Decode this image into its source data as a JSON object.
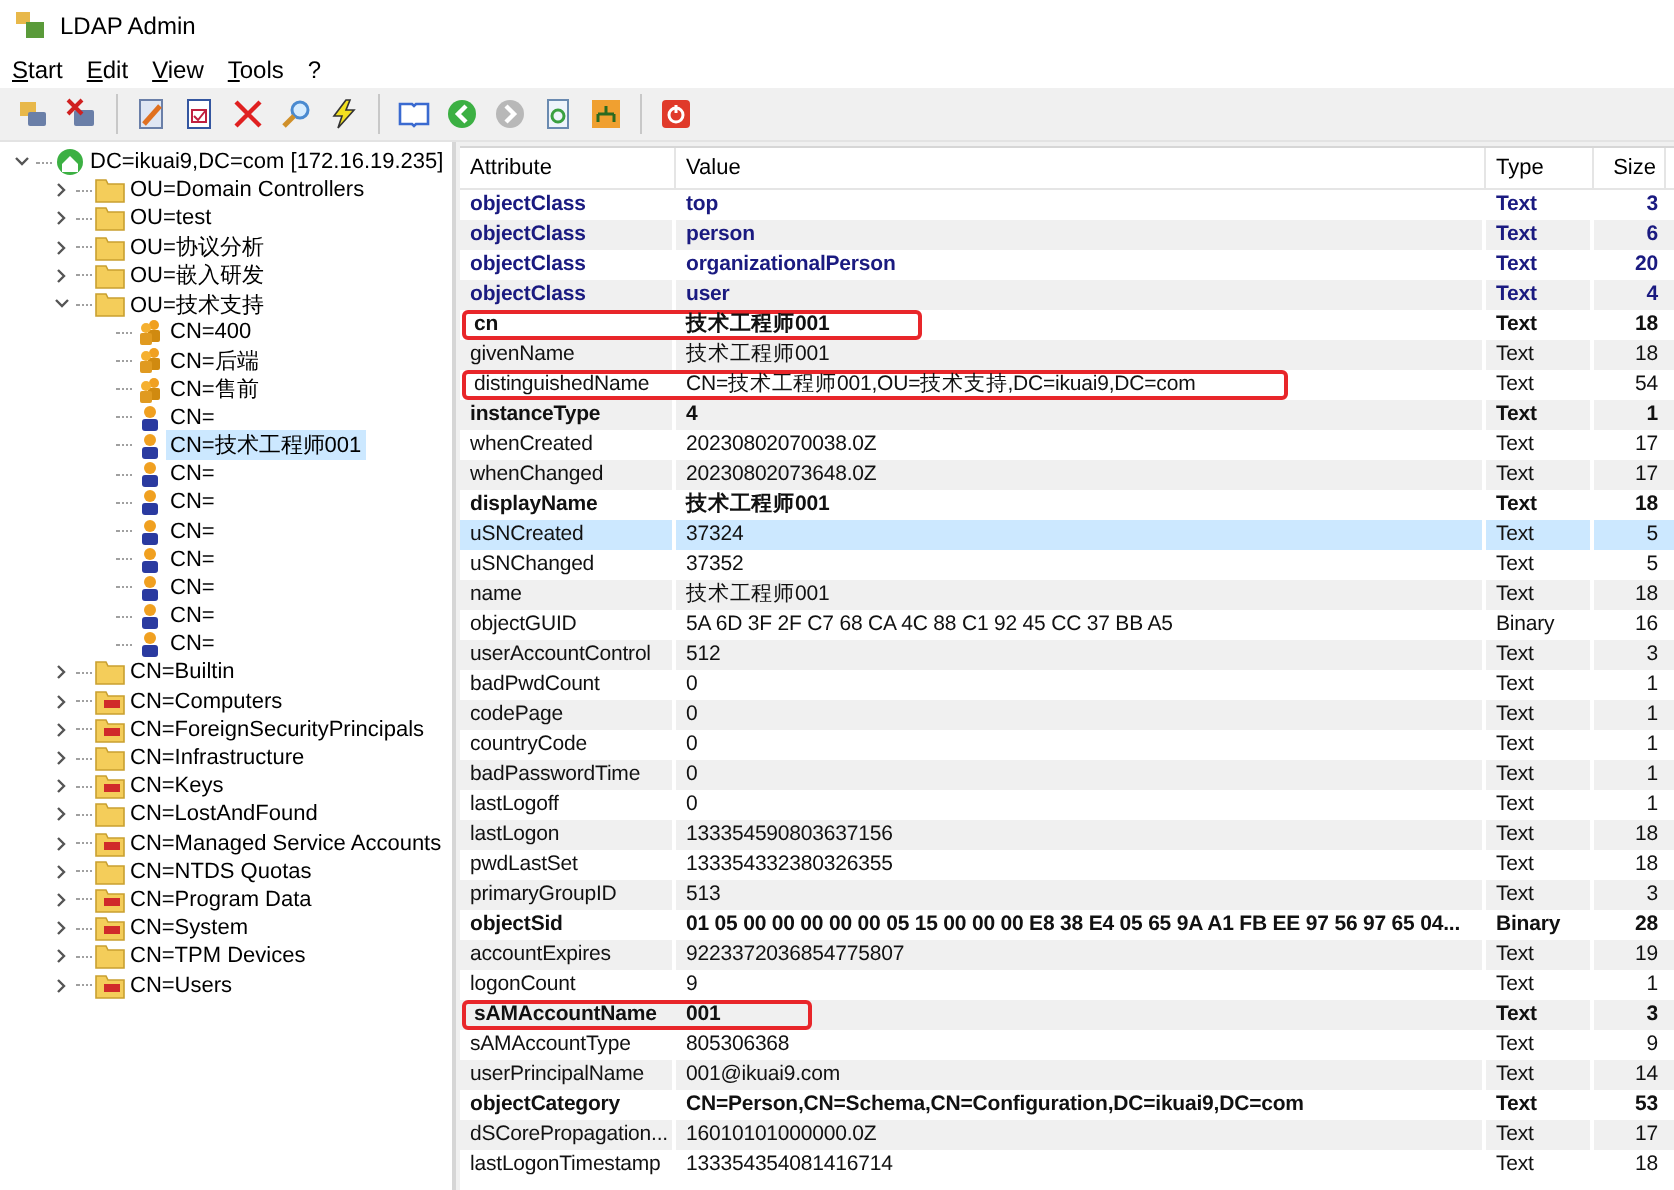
{
  "window": {
    "title": "LDAP Admin"
  },
  "menu": [
    "Start",
    "Edit",
    "View",
    "Tools",
    "?"
  ],
  "tree": {
    "label": "DC=ikuai9,DC=com [172.16.19.235]",
    "expanded": true,
    "children": [
      {
        "label": "OU=Domain Controllers",
        "kind": "folder",
        "expanded": false,
        "selected": false
      },
      {
        "label": "OU=test",
        "kind": "folder",
        "expanded": false,
        "selected": false
      },
      {
        "label": "OU=协议分析",
        "kind": "folder",
        "expanded": false,
        "selected": false
      },
      {
        "label": "OU=嵌入研发",
        "kind": "folder",
        "expanded": false,
        "selected": false
      },
      {
        "label": "OU=技术支持",
        "kind": "folder",
        "expanded": true,
        "selected": false,
        "children": [
          {
            "label": "CN=400",
            "kind": "group",
            "selected": false
          },
          {
            "label": "CN=后端",
            "kind": "group",
            "selected": false
          },
          {
            "label": "CN=售前",
            "kind": "group",
            "selected": false
          },
          {
            "label": "CN=",
            "kind": "user",
            "selected": false
          },
          {
            "label": "CN=技术工程师001",
            "kind": "user",
            "selected": true
          },
          {
            "label": "CN=",
            "kind": "user",
            "selected": false
          },
          {
            "label": "CN=",
            "kind": "user",
            "selected": false
          },
          {
            "label": "CN=",
            "kind": "user",
            "selected": false
          },
          {
            "label": "CN=",
            "kind": "user",
            "selected": false
          },
          {
            "label": "CN=",
            "kind": "user",
            "selected": false
          },
          {
            "label": "CN=",
            "kind": "user",
            "selected": false
          },
          {
            "label": "CN=",
            "kind": "user",
            "selected": false
          }
        ]
      },
      {
        "label": "CN=Builtin",
        "kind": "folder",
        "expanded": false,
        "selected": false
      },
      {
        "label": "CN=Computers",
        "kind": "container",
        "expanded": false,
        "selected": false
      },
      {
        "label": "CN=ForeignSecurityPrincipals",
        "kind": "container",
        "expanded": false,
        "selected": false
      },
      {
        "label": "CN=Infrastructure",
        "kind": "folder",
        "expanded": false,
        "selected": false
      },
      {
        "label": "CN=Keys",
        "kind": "container",
        "expanded": false,
        "selected": false
      },
      {
        "label": "CN=LostAndFound",
        "kind": "folder",
        "expanded": false,
        "selected": false
      },
      {
        "label": "CN=Managed Service Accounts",
        "kind": "container",
        "expanded": false,
        "selected": false
      },
      {
        "label": "CN=NTDS Quotas",
        "kind": "folder",
        "expanded": false,
        "selected": false
      },
      {
        "label": "CN=Program Data",
        "kind": "container",
        "expanded": false,
        "selected": false
      },
      {
        "label": "CN=System",
        "kind": "container",
        "expanded": false,
        "selected": false
      },
      {
        "label": "CN=TPM Devices",
        "kind": "folder",
        "expanded": false,
        "selected": false
      },
      {
        "label": "CN=Users",
        "kind": "container",
        "expanded": false,
        "selected": false
      }
    ]
  },
  "table": {
    "columns": [
      "Attribute",
      "Value",
      "Type",
      "Size"
    ],
    "rows": [
      {
        "attribute": "objectClass",
        "value": "top",
        "type": "Text",
        "size": "3",
        "kind": "class",
        "selected": false,
        "marked": false
      },
      {
        "attribute": "objectClass",
        "value": "person",
        "type": "Text",
        "size": "6",
        "kind": "class",
        "selected": false,
        "marked": false
      },
      {
        "attribute": "objectClass",
        "value": "organizationalPerson",
        "type": "Text",
        "size": "20",
        "kind": "class",
        "selected": false,
        "marked": false
      },
      {
        "attribute": "objectClass",
        "value": "user",
        "type": "Text",
        "size": "4",
        "kind": "class",
        "selected": false,
        "marked": false
      },
      {
        "attribute": "cn",
        "value": "技术工程师001",
        "type": "Text",
        "size": "18",
        "kind": "bold",
        "selected": false,
        "marked": true
      },
      {
        "attribute": "givenName",
        "value": "技术工程师001",
        "type": "Text",
        "size": "18",
        "kind": "normal",
        "selected": false,
        "marked": false
      },
      {
        "attribute": "distinguishedName",
        "value": "CN=技术工程师001,OU=技术支持,DC=ikuai9,DC=com",
        "type": "Text",
        "size": "54",
        "kind": "normal",
        "selected": false,
        "marked": true
      },
      {
        "attribute": "instanceType",
        "value": "4",
        "type": "Text",
        "size": "1",
        "kind": "bold",
        "selected": false,
        "marked": false
      },
      {
        "attribute": "whenCreated",
        "value": "20230802070038.0Z",
        "type": "Text",
        "size": "17",
        "kind": "normal",
        "selected": false,
        "marked": false
      },
      {
        "attribute": "whenChanged",
        "value": "20230802073648.0Z",
        "type": "Text",
        "size": "17",
        "kind": "normal",
        "selected": false,
        "marked": false
      },
      {
        "attribute": "displayName",
        "value": "技术工程师001",
        "type": "Text",
        "size": "18",
        "kind": "bold",
        "selected": false,
        "marked": false
      },
      {
        "attribute": "uSNCreated",
        "value": "37324",
        "type": "Text",
        "size": "5",
        "kind": "normal",
        "selected": true,
        "marked": false
      },
      {
        "attribute": "uSNChanged",
        "value": "37352",
        "type": "Text",
        "size": "5",
        "kind": "normal",
        "selected": false,
        "marked": false
      },
      {
        "attribute": "name",
        "value": "技术工程师001",
        "type": "Text",
        "size": "18",
        "kind": "normal",
        "selected": false,
        "marked": false
      },
      {
        "attribute": "objectGUID",
        "value": "5A 6D 3F 2F C7 68 CA 4C 88 C1 92 45 CC 37 BB A5",
        "type": "Binary",
        "size": "16",
        "kind": "normal",
        "selected": false,
        "marked": false
      },
      {
        "attribute": "userAccountControl",
        "value": "512",
        "type": "Text",
        "size": "3",
        "kind": "normal",
        "selected": false,
        "marked": false
      },
      {
        "attribute": "badPwdCount",
        "value": "0",
        "type": "Text",
        "size": "1",
        "kind": "normal",
        "selected": false,
        "marked": false
      },
      {
        "attribute": "codePage",
        "value": "0",
        "type": "Text",
        "size": "1",
        "kind": "normal",
        "selected": false,
        "marked": false
      },
      {
        "attribute": "countryCode",
        "value": "0",
        "type": "Text",
        "size": "1",
        "kind": "normal",
        "selected": false,
        "marked": false
      },
      {
        "attribute": "badPasswordTime",
        "value": "0",
        "type": "Text",
        "size": "1",
        "kind": "normal",
        "selected": false,
        "marked": false
      },
      {
        "attribute": "lastLogoff",
        "value": "0",
        "type": "Text",
        "size": "1",
        "kind": "normal",
        "selected": false,
        "marked": false
      },
      {
        "attribute": "lastLogon",
        "value": "133354590803637156",
        "type": "Text",
        "size": "18",
        "kind": "normal",
        "selected": false,
        "marked": false
      },
      {
        "attribute": "pwdLastSet",
        "value": "133354332380326355",
        "type": "Text",
        "size": "18",
        "kind": "normal",
        "selected": false,
        "marked": false
      },
      {
        "attribute": "primaryGroupID",
        "value": "513",
        "type": "Text",
        "size": "3",
        "kind": "normal",
        "selected": false,
        "marked": false
      },
      {
        "attribute": "objectSid",
        "value": "01 05 00 00 00 00 00 05 15 00 00 00 E8 38 E4 05 65 9A A1 FB EE 97 56 97 65 04...",
        "type": "Binary",
        "size": "28",
        "kind": "bold",
        "selected": false,
        "marked": false
      },
      {
        "attribute": "accountExpires",
        "value": "9223372036854775807",
        "type": "Text",
        "size": "19",
        "kind": "normal",
        "selected": false,
        "marked": false
      },
      {
        "attribute": "logonCount",
        "value": "9",
        "type": "Text",
        "size": "1",
        "kind": "normal",
        "selected": false,
        "marked": false
      },
      {
        "attribute": "sAMAccountName",
        "value": "001",
        "type": "Text",
        "size": "3",
        "kind": "bold",
        "selected": false,
        "marked": true
      },
      {
        "attribute": "sAMAccountType",
        "value": "805306368",
        "type": "Text",
        "size": "9",
        "kind": "normal",
        "selected": false,
        "marked": false
      },
      {
        "attribute": "userPrincipalName",
        "value": "001@ikuai9.com",
        "type": "Text",
        "size": "14",
        "kind": "normal",
        "selected": false,
        "marked": false
      },
      {
        "attribute": "objectCategory",
        "value": "CN=Person,CN=Schema,CN=Configuration,DC=ikuai9,DC=com",
        "type": "Text",
        "size": "53",
        "kind": "bold",
        "selected": false,
        "marked": false
      },
      {
        "attribute": "dSCorePropagation...",
        "value": "16010101000000.0Z",
        "type": "Text",
        "size": "17",
        "kind": "normal",
        "selected": false,
        "marked": false
      },
      {
        "attribute": "lastLogonTimestamp",
        "value": "133354354081416714",
        "type": "Text",
        "size": "18",
        "kind": "normal",
        "selected": false,
        "marked": false
      }
    ]
  }
}
